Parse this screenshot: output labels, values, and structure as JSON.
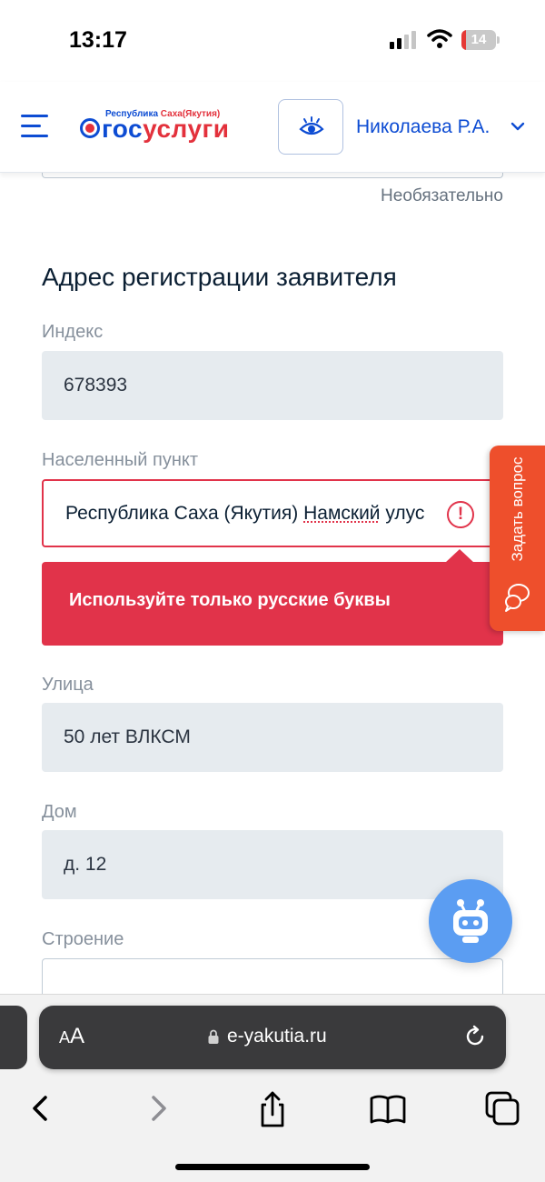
{
  "status_bar": {
    "time": "13:17",
    "battery_level": 14,
    "battery_label": "14",
    "icons": [
      "signal-icon",
      "wifi-icon",
      "battery-icon"
    ]
  },
  "header": {
    "logo_region_prefix": "Республика ",
    "logo_region_suffix": "Саха(Якутия)",
    "logo_text_blue": "гос",
    "logo_text_red": "услуги",
    "user_name": "Николаева Р.А.",
    "icons": [
      "menu-icon",
      "eye-icon",
      "chevron-down-icon"
    ]
  },
  "form": {
    "optional_hint": "Необязательно",
    "section_title": "Адрес регистрации заявителя",
    "index": {
      "label": "Индекс",
      "value": "678393"
    },
    "locality": {
      "label": "Населенный пункт",
      "value_prefix": "Республика Саха (Якутия) ",
      "value_underlined": "Намский",
      "value_suffix": " улус",
      "error": "Используйте только русские буквы"
    },
    "street": {
      "label": "Улица",
      "value": "50 лет ВЛКСМ"
    },
    "house": {
      "label": "Дом",
      "value": "д. 12"
    },
    "building": {
      "label": "Строение",
      "value": ""
    }
  },
  "ask_question": {
    "label": "Задать вопрос"
  },
  "browser": {
    "aa_small": "A",
    "aa_large": "A",
    "url": "e-yakutia.ru",
    "icons": [
      "lock-icon",
      "reload-icon",
      "back-icon",
      "forward-icon",
      "share-icon",
      "bookmarks-icon",
      "tabs-icon"
    ]
  },
  "colors": {
    "accent": "#0d4cd3",
    "error": "#e1334a",
    "ask_tab": "#ee4f2c",
    "bot_fab": "#5b9df2"
  }
}
